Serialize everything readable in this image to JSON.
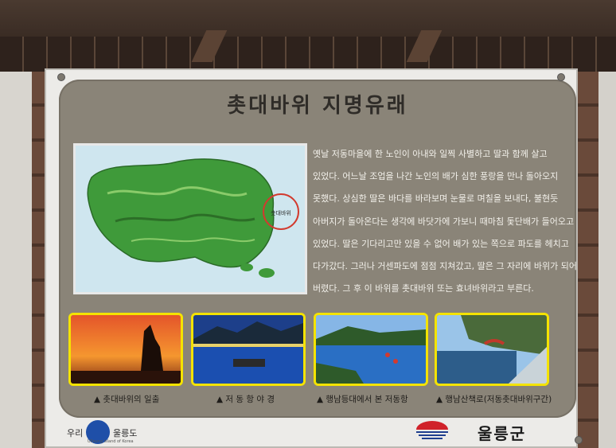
{
  "sign": {
    "title": "촛대바위 지명유래",
    "story_lines": [
      "옛날 저동마을에 한 노인이 아내와 일찍 사별하고 딸과 함께 살고",
      "있었다. 어느날 조업을 나간 노인의 배가 심한 풍랑을 만나 돌아오지",
      "못했다. 상심한 딸은 바다를 바라보며 눈물로 며칠을 보내다, 불현듯",
      "아버지가 돌아온다는 생각에 바닷가에 가보니 때마침 돛단배가 들어오고",
      "있었다. 딸은 기다리고만 있을 수 없어 배가 있는 쪽으로 파도를 헤치고",
      "다가갔다. 그러나 거센파도에 점점 지쳐갔고, 딸은 그 자리에 바위가 되어",
      "버렸다. 그 후 이 바위를 촛대바위 또는 효녀바위라고 부른다."
    ],
    "map_label": "촛대바위",
    "photos": [
      {
        "caption": "▲ 촛대바위의 일출"
      },
      {
        "caption": "▲ 저 동 항 야 경"
      },
      {
        "caption": "▲ 행남등대에서 본 저동항"
      },
      {
        "caption": "▲ 행남산책로(저동촛대바위구간)"
      }
    ],
    "footer": {
      "brand_left_1": "우리",
      "brand_left_2": "울릉도",
      "brand_left_sub": "Ulleung island of Korea",
      "county": "울릉군"
    }
  },
  "colors": {
    "panel": "#8a8478",
    "frame_highlight": "#f4e300",
    "text_light": "#f2f0ea"
  }
}
